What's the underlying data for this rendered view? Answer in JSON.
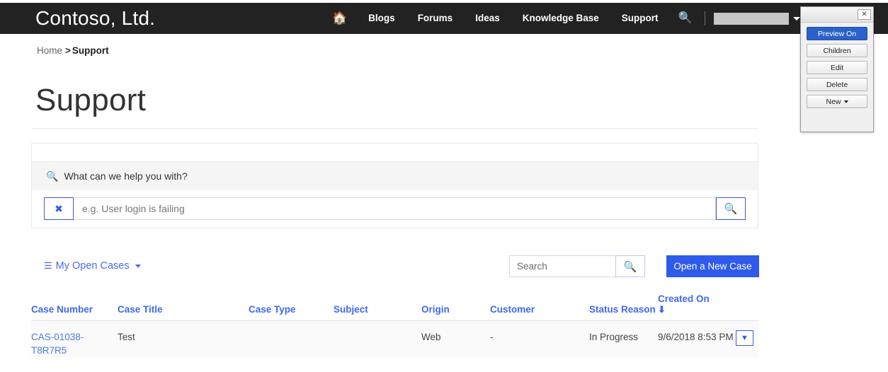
{
  "navbar": {
    "brand": "Contoso, Ltd.",
    "home_icon": "home-icon",
    "links": [
      "Blogs",
      "Forums",
      "Ideas",
      "Knowledge Base",
      "Support"
    ],
    "search_icon": "search-icon",
    "user_menu_label": ""
  },
  "breadcrumb": {
    "home": "Home",
    "separator": ">",
    "current": "Support"
  },
  "page": {
    "title": "Support"
  },
  "search_panel": {
    "heading": "What can we help you with?",
    "heading_icon": "search-icon",
    "clear_icon": "clear-x-icon",
    "input_value": "",
    "input_placeholder": "e.g. User login is failing",
    "submit_icon": "search-icon"
  },
  "toolbar": {
    "view_icon": "list-icon",
    "view_label": "My Open Cases",
    "view_caret": "chevron-down-icon",
    "search_value": "",
    "search_placeholder": "Search",
    "search_icon": "search-icon",
    "new_case_label": "Open a New Case"
  },
  "table": {
    "columns": [
      {
        "label": "Case Number",
        "sorted": false
      },
      {
        "label": "Case Title",
        "sorted": false
      },
      {
        "label": "Case Type",
        "sorted": false
      },
      {
        "label": "Subject",
        "sorted": false
      },
      {
        "label": "Origin",
        "sorted": false
      },
      {
        "label": "Customer",
        "sorted": false
      },
      {
        "label": "Status Reason",
        "sorted": false
      },
      {
        "label": "Created On",
        "sorted": true,
        "sort_icon": "arrow-down-icon"
      }
    ],
    "rows": [
      {
        "case_number": "CAS-01038-T8R7R5",
        "case_title": "Test",
        "case_type": "",
        "subject": "",
        "origin": "Web",
        "customer": "-",
        "status_reason": "In Progress",
        "created_on": "9/6/2018 8:53 PM",
        "row_menu_icon": "chevron-down-icon"
      }
    ]
  },
  "edit_panel": {
    "close_label": "✕",
    "buttons": [
      {
        "label": "Preview On",
        "primary": true,
        "has_caret": false
      },
      {
        "label": "Children",
        "primary": false,
        "has_caret": false
      },
      {
        "label": "Edit",
        "primary": false,
        "has_caret": false
      },
      {
        "label": "Delete",
        "primary": false,
        "has_caret": false
      },
      {
        "label": "New",
        "primary": false,
        "has_caret": true
      }
    ]
  },
  "colors": {
    "nav_bg": "#222222",
    "accent_blue": "#2f5bea",
    "link_blue": "#4a7ae0",
    "header_blue": "#3f68f0",
    "panel_gray": "#f5f5f5",
    "row_gray": "#fafafa"
  }
}
